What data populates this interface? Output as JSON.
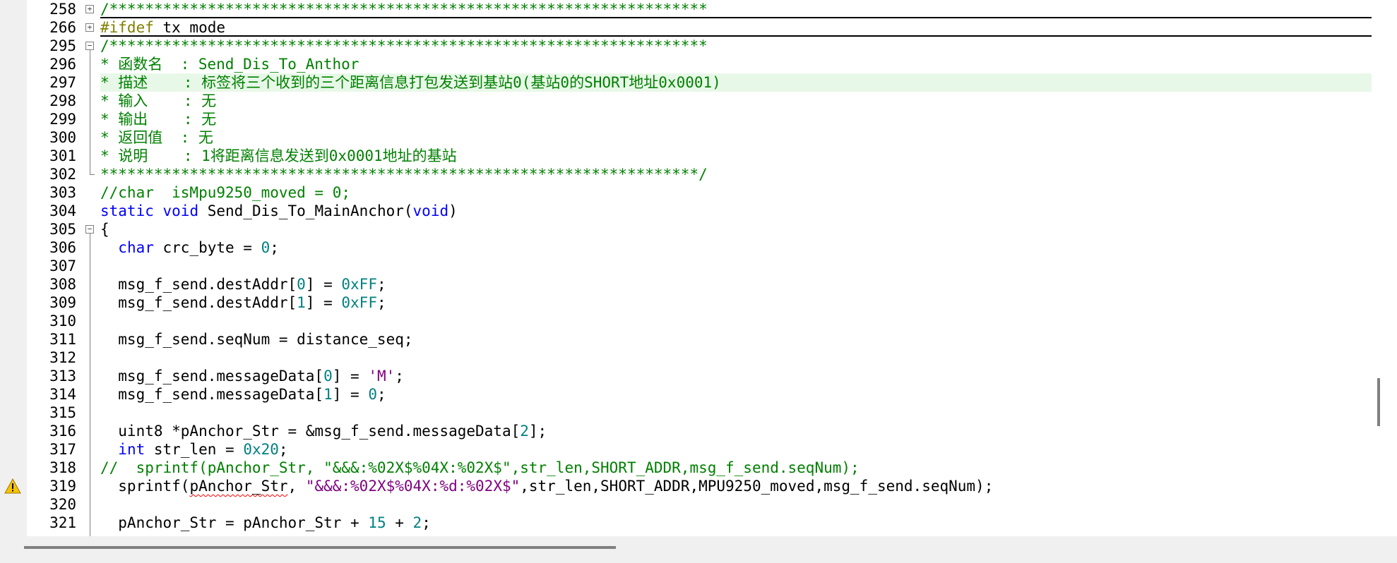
{
  "editor": {
    "lines": [
      {
        "n": "258",
        "fold": "plus",
        "tokens": [
          [
            "c",
            "/*******************************************************************"
          ]
        ],
        "boxed": true
      },
      {
        "n": "266",
        "fold": "plus",
        "tokens": [
          [
            "pp",
            "#ifdef"
          ],
          [
            "t",
            " tx_mode"
          ]
        ],
        "boxed": true
      },
      {
        "n": "295",
        "fold": "minus",
        "tokens": [
          [
            "c",
            "/*******************************************************************"
          ]
        ]
      },
      {
        "n": "296",
        "tokens": [
          [
            "c",
            "* 函数名  : Send_Dis_To_Anthor"
          ]
        ]
      },
      {
        "n": "297",
        "hl": true,
        "tokens": [
          [
            "c",
            "* 描述    : 标签将三个收到的三个距离信息打包发送到基站0(基站0的SHORT地址0x0001)"
          ]
        ]
      },
      {
        "n": "298",
        "tokens": [
          [
            "c",
            "* 输入    : 无"
          ]
        ]
      },
      {
        "n": "299",
        "tokens": [
          [
            "c",
            "* 输出    : 无"
          ]
        ]
      },
      {
        "n": "300",
        "tokens": [
          [
            "c",
            "* 返回值  : 无"
          ]
        ]
      },
      {
        "n": "301",
        "tokens": [
          [
            "c",
            "* 说明    : 1将距离信息发送到0x0001地址的基站"
          ]
        ]
      },
      {
        "n": "302",
        "foldEnd": true,
        "tokens": [
          [
            "c",
            "*******************************************************************/"
          ]
        ]
      },
      {
        "n": "303",
        "tokens": [
          [
            "c",
            "//char  isMpu9250_moved = 0;"
          ]
        ]
      },
      {
        "n": "304",
        "tokens": [
          [
            "k",
            "static"
          ],
          [
            "t",
            " "
          ],
          [
            "k",
            "void"
          ],
          [
            "t",
            " Send_Dis_To_MainAnchor("
          ],
          [
            "k",
            "void"
          ],
          [
            "t",
            ")"
          ]
        ]
      },
      {
        "n": "305",
        "fold": "minus",
        "tokens": [
          [
            "t",
            "{"
          ]
        ]
      },
      {
        "n": "306",
        "tokens": [
          [
            "t",
            "  "
          ],
          [
            "k",
            "char"
          ],
          [
            "t",
            " crc_byte = "
          ],
          [
            "n",
            "0"
          ],
          [
            "t",
            ";"
          ]
        ]
      },
      {
        "n": "307",
        "tokens": []
      },
      {
        "n": "308",
        "tokens": [
          [
            "t",
            "  msg_f_send.destAddr["
          ],
          [
            "n",
            "0"
          ],
          [
            "t",
            "] = "
          ],
          [
            "n",
            "0xFF"
          ],
          [
            "t",
            ";"
          ]
        ]
      },
      {
        "n": "309",
        "tokens": [
          [
            "t",
            "  msg_f_send.destAddr["
          ],
          [
            "n",
            "1"
          ],
          [
            "t",
            "] = "
          ],
          [
            "n",
            "0xFF"
          ],
          [
            "t",
            ";"
          ]
        ]
      },
      {
        "n": "310",
        "tokens": []
      },
      {
        "n": "311",
        "tokens": [
          [
            "t",
            "  msg_f_send.seqNum = distance_seq;"
          ]
        ]
      },
      {
        "n": "312",
        "tokens": []
      },
      {
        "n": "313",
        "tokens": [
          [
            "t",
            "  msg_f_send.messageData["
          ],
          [
            "n",
            "0"
          ],
          [
            "t",
            "] = "
          ],
          [
            "s",
            "'M'"
          ],
          [
            "t",
            ";"
          ]
        ]
      },
      {
        "n": "314",
        "tokens": [
          [
            "t",
            "  msg_f_send.messageData["
          ],
          [
            "n",
            "1"
          ],
          [
            "t",
            "] = "
          ],
          [
            "n",
            "0"
          ],
          [
            "t",
            ";"
          ]
        ]
      },
      {
        "n": "315",
        "tokens": []
      },
      {
        "n": "316",
        "tokens": [
          [
            "t",
            "  uint8 *pAnchor_Str = &msg_f_send.messageData["
          ],
          [
            "n",
            "2"
          ],
          [
            "t",
            "];"
          ]
        ]
      },
      {
        "n": "317",
        "tokens": [
          [
            "t",
            "  "
          ],
          [
            "k",
            "int"
          ],
          [
            "t",
            " str_len = "
          ],
          [
            "n",
            "0x20"
          ],
          [
            "t",
            ";"
          ]
        ]
      },
      {
        "n": "318",
        "tokens": [
          [
            "c",
            "//  sprintf(pAnchor_Str, \"&&&:%02X$%04X:%02X$\",str_len,SHORT_ADDR,msg_f_send.seqNum);"
          ]
        ]
      },
      {
        "n": "319",
        "warn": true,
        "tokens": [
          [
            "t",
            "  sprintf("
          ],
          [
            "sq",
            "pAnchor_Str"
          ],
          [
            "t",
            ", "
          ],
          [
            "s",
            "\"&&&:%02X$%04X:%d:%02X$\""
          ],
          [
            "t",
            ",str_len,SHORT_ADDR,MPU9250_moved,msg_f_send.seqNum);"
          ]
        ]
      },
      {
        "n": "320",
        "tokens": []
      },
      {
        "n": "321",
        "tokens": [
          [
            "t",
            "  pAnchor_Str = pAnchor_Str + "
          ],
          [
            "n",
            "15"
          ],
          [
            "t",
            " + "
          ],
          [
            "n",
            "2"
          ],
          [
            "t",
            ";"
          ]
        ]
      }
    ]
  },
  "colors": {
    "comment": "#008000",
    "keyword": "#0000ff",
    "number": "#008080",
    "string": "#800080",
    "preprocessor": "#808000",
    "highlight_line": "#e8f8e8"
  },
  "icons": {
    "fold_expand": "plus-box-icon",
    "fold_collapse": "minus-box-icon",
    "warning": "warning-triangle-icon"
  }
}
